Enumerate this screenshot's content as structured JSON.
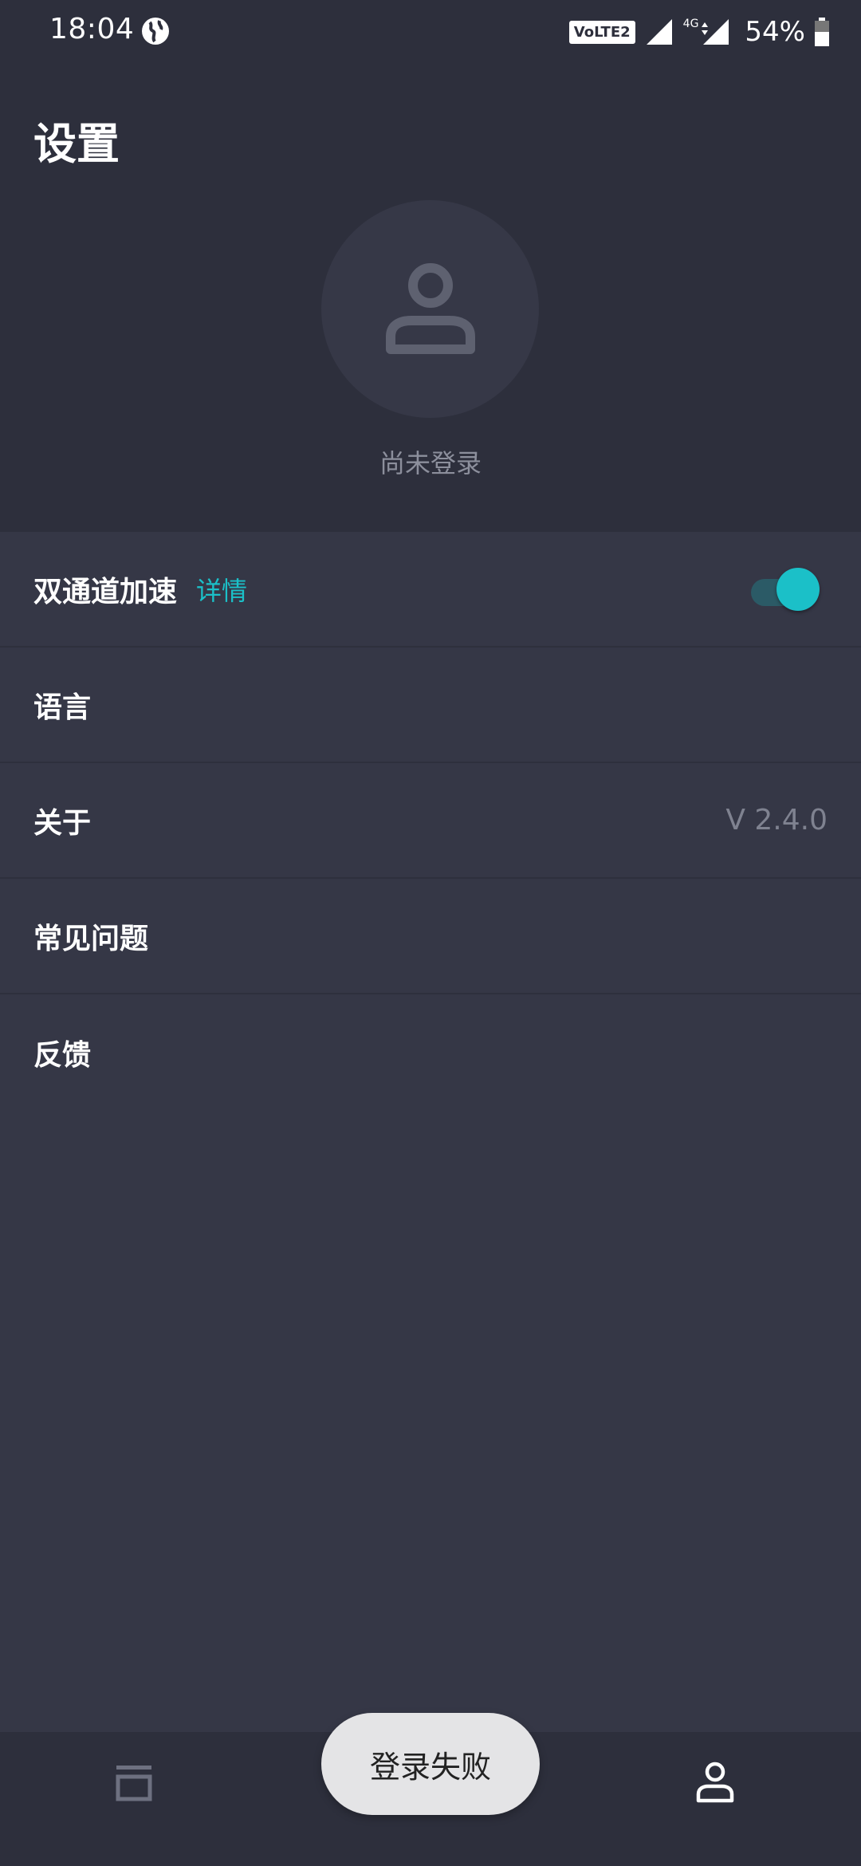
{
  "status_bar": {
    "time": "18:04",
    "volte": "VoLTE2",
    "network": "4G",
    "battery": "54%"
  },
  "header": {
    "title": "设置",
    "login_status": "尚未登录"
  },
  "settings": {
    "items": [
      {
        "label": "双通道加速",
        "link": "详情",
        "toggle_on": true
      },
      {
        "label": "语言"
      },
      {
        "label": "关于",
        "value": "V 2.4.0"
      },
      {
        "label": "常见问题"
      },
      {
        "label": "反馈"
      }
    ]
  },
  "bottom_nav": {
    "items": [
      "cards-icon",
      "globe-icon",
      "user-icon"
    ],
    "active": "user-icon"
  },
  "toast": {
    "message": "登录失败"
  },
  "colors": {
    "accent": "#1bc0c8",
    "header_bg": "#2d2f3c",
    "list_bg": "#353746"
  }
}
